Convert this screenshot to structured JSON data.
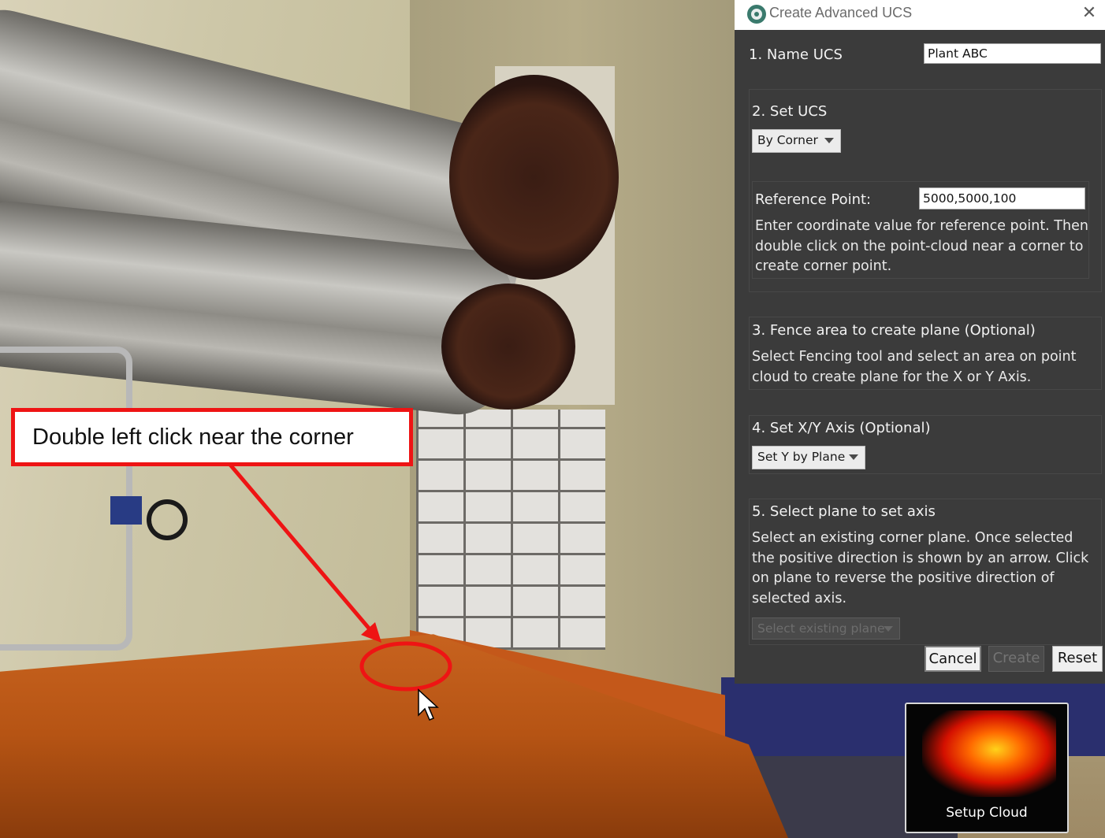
{
  "annotation": {
    "callout_text": "Double left click near the corner"
  },
  "dialog": {
    "title": "Create Advanced UCS",
    "step1": {
      "label": "1. Name UCS",
      "value": "Plant ABC"
    },
    "step2": {
      "label": "2. Set UCS",
      "method": "By Corner",
      "reference_label": "Reference Point:",
      "reference_value": "5000,5000,100",
      "help": "Enter coordinate value for reference point. Then double click on the point-cloud near a corner to create corner point."
    },
    "step3": {
      "label": "3. Fence area to create plane (Optional)",
      "help": "Select Fencing tool and select an area on point cloud to create plane for the X or Y Axis."
    },
    "step4": {
      "label": "4. Set X/Y Axis (Optional)",
      "axis_option": "Set Y by Plane"
    },
    "step5": {
      "label": "5. Select plane to set axis",
      "help": "Select an existing corner plane. Once selected the positive direction is shown by an arrow. Click on plane to reverse the positive direction of selected axis.",
      "plane_placeholder": "Select existing plane"
    },
    "buttons": {
      "cancel": "Cancel",
      "create": "Create",
      "reset": "Reset"
    }
  },
  "thumbnail": {
    "label": "Setup Cloud"
  },
  "colors": {
    "annotation_red": "#ee1414",
    "dialog_bg": "#3b3b3b",
    "floor_orange": "#c8631f"
  }
}
